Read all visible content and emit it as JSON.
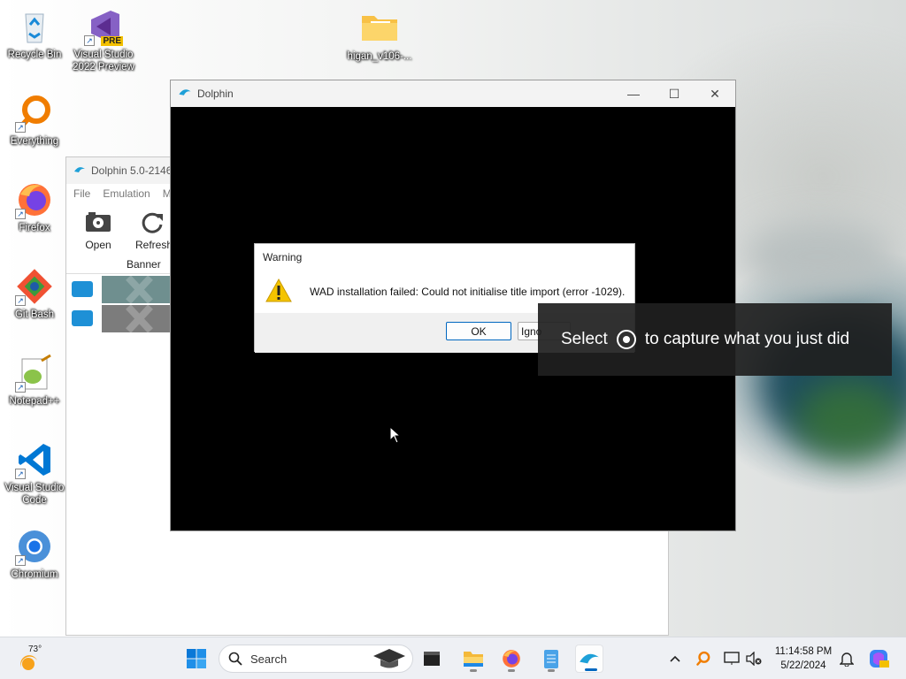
{
  "desktop": {
    "icons": [
      {
        "label": "Recycle Bin",
        "icon": "recycle-bin-icon"
      },
      {
        "label": "Visual Studio\n2022 Preview",
        "icon": "visual-studio-icon",
        "badge": "PRE"
      },
      {
        "label": "higan_v106-...",
        "icon": "folder-icon"
      },
      {
        "label": "Everything",
        "icon": "everything-search-icon"
      },
      {
        "label": "Firefox",
        "icon": "firefox-icon"
      },
      {
        "label": "Git Bash",
        "icon": "git-bash-icon"
      },
      {
        "label": "Notepad++",
        "icon": "notepadpp-icon"
      },
      {
        "label": "Visual Studio\nCode",
        "icon": "vscode-icon"
      },
      {
        "label": "Chromium",
        "icon": "chromium-icon"
      }
    ]
  },
  "main_window": {
    "title": "Dolphin 5.0-2146",
    "menu": [
      "File",
      "Emulation",
      "M"
    ],
    "toolbar": [
      {
        "label": "Open",
        "icon": "open-disc-icon"
      },
      {
        "label": "Refresh",
        "icon": "refresh-icon"
      }
    ],
    "list_header": {
      "banner": "Banner"
    }
  },
  "render_window": {
    "title": "Dolphin",
    "controls": {
      "minimize": "—",
      "maximize": "☐",
      "close": "✕"
    }
  },
  "dialog": {
    "title": "Warning",
    "message": "WAD installation failed: Could not initialise title import (error -1029).",
    "ok_label": "OK",
    "ignore_label": "Igno",
    "icon": "warning-icon"
  },
  "toast": {
    "prefix": "Select",
    "suffix": "to capture what you just did",
    "icon": "record-icon"
  },
  "taskbar": {
    "weather_temp": "73°",
    "search_placeholder": "Search",
    "clock_time": "11:14:58 PM",
    "clock_date": "5/22/2024"
  },
  "colors": {
    "accent": "#0067c0",
    "dialog_footer": "#f0f0f0",
    "toast_bg": "#202020",
    "warning_yellow": "#f4c400"
  }
}
